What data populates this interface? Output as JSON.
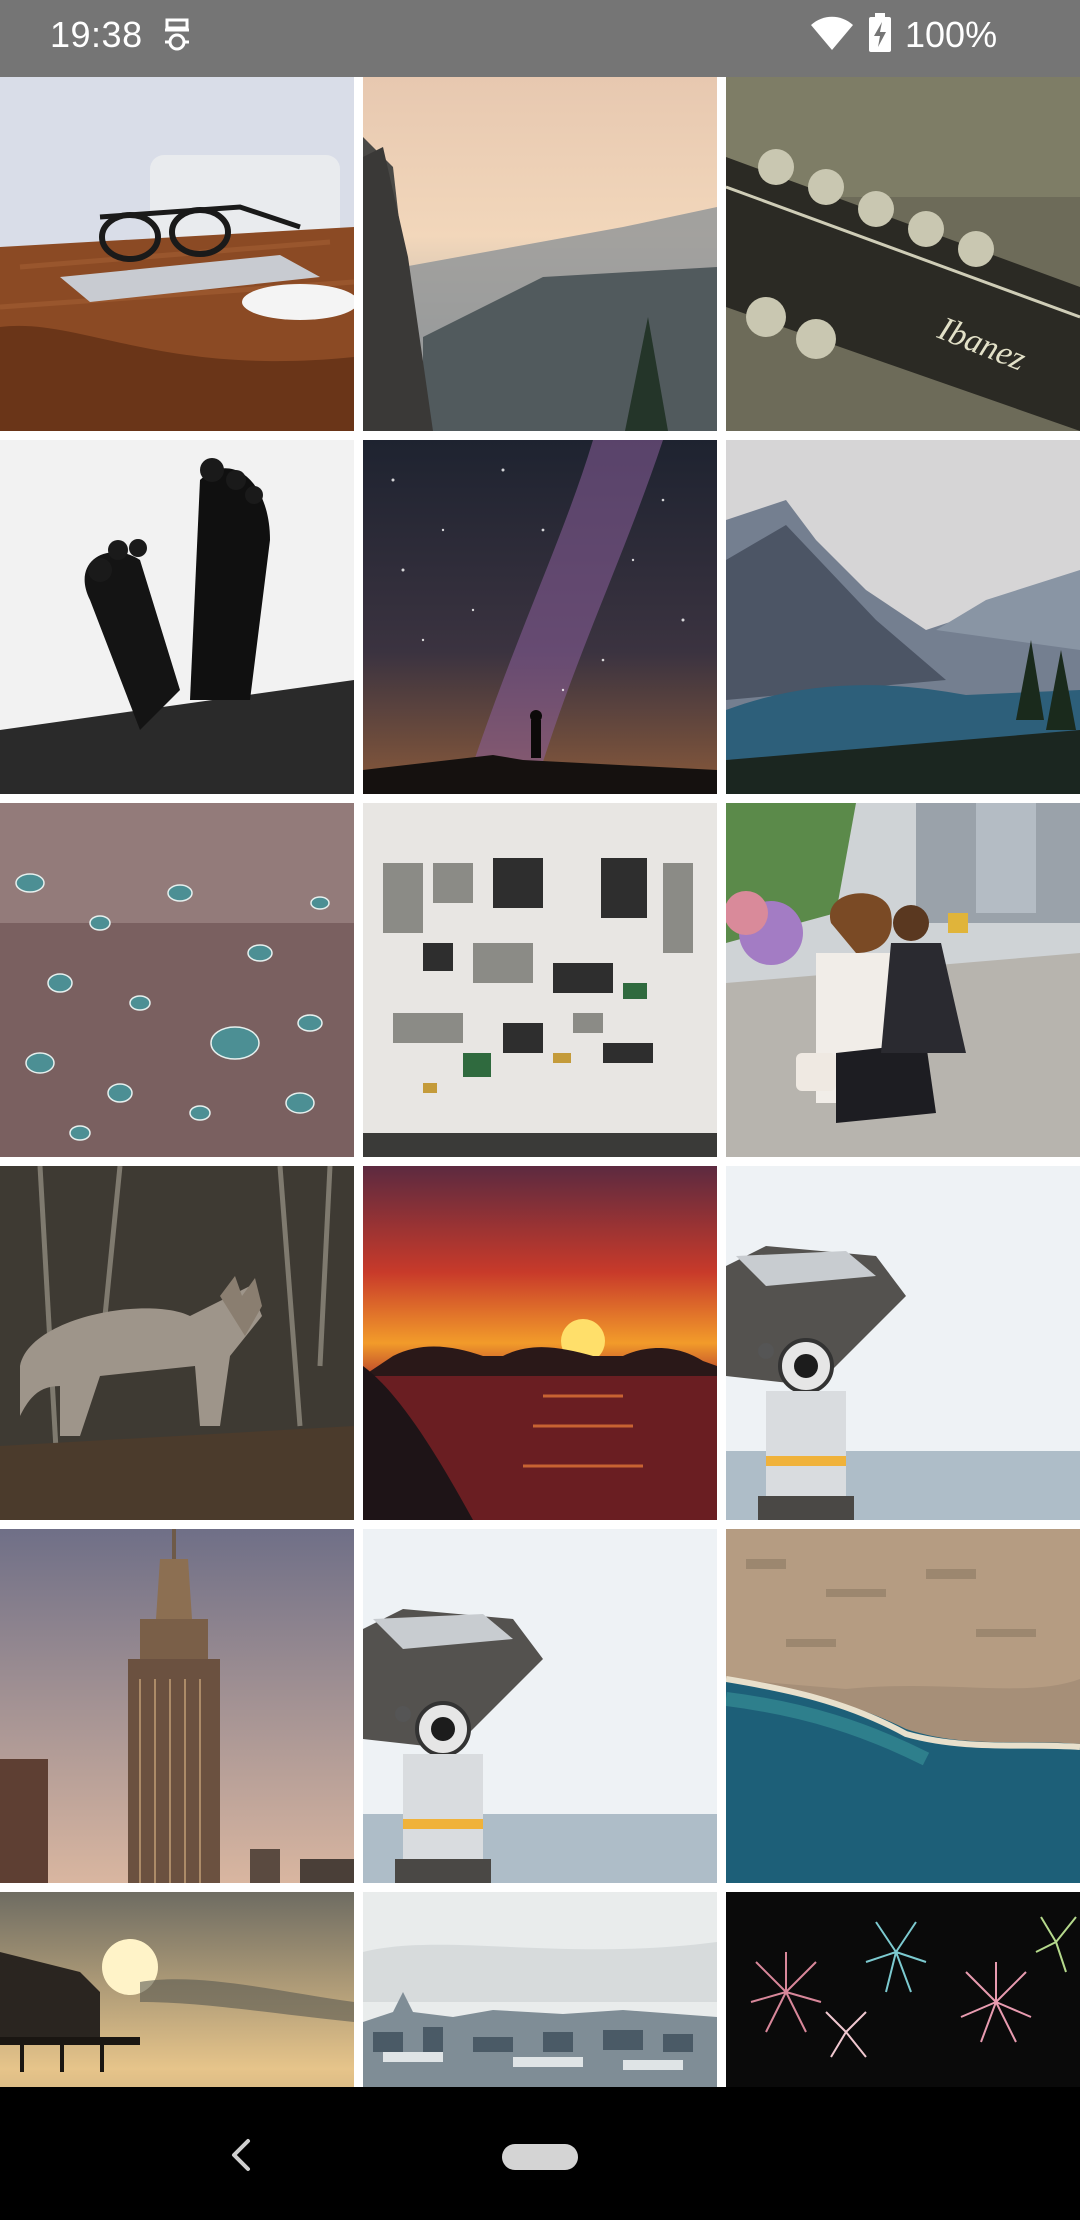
{
  "status_bar": {
    "time": "19:38",
    "battery_percent": "100%",
    "icons": [
      "incognito-icon",
      "wifi-icon",
      "battery-charging-icon"
    ],
    "background": "#757575"
  },
  "gallery": {
    "columns": 3,
    "tiles": [
      {
        "name": "photo-desk-glasses-laptop"
      },
      {
        "name": "photo-mountain-valley-sunrise"
      },
      {
        "name": "photo-guitar-headstock"
      },
      {
        "name": "photo-feet-silhouette"
      },
      {
        "name": "photo-milky-way-person"
      },
      {
        "name": "photo-mountain-lake"
      },
      {
        "name": "photo-water-droplets"
      },
      {
        "name": "photo-disassembled-camera-parts"
      },
      {
        "name": "photo-mother-daughter-street"
      },
      {
        "name": "photo-coyote-forest"
      },
      {
        "name": "photo-ocean-sunset"
      },
      {
        "name": "photo-tower-viewer-binoculars"
      },
      {
        "name": "photo-empire-state-building"
      },
      {
        "name": "photo-tower-viewer-binoculars-2"
      },
      {
        "name": "photo-aerial-coastline"
      },
      {
        "name": "photo-pier-sunset"
      },
      {
        "name": "photo-city-skyline"
      },
      {
        "name": "photo-fireworks"
      }
    ]
  },
  "nav_bar": {
    "background": "#000000",
    "icons": [
      "back-icon",
      "home-pill"
    ]
  }
}
